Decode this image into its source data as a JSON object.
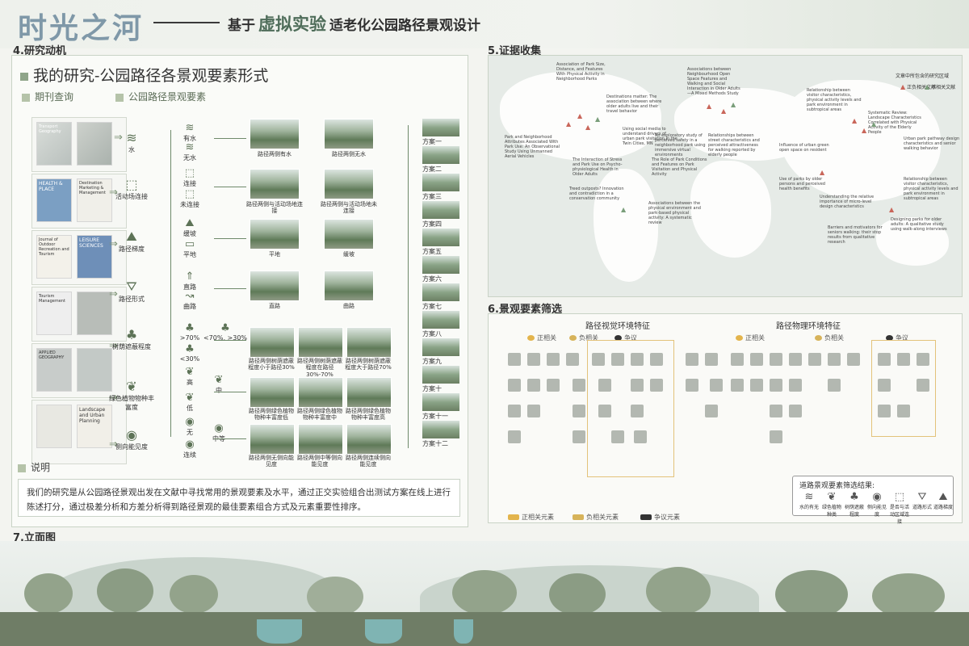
{
  "header": {
    "title": "时光之河",
    "subtitle_prefix": "基于",
    "subtitle_emph": "虚拟实验",
    "subtitle_suffix": "适老化公园路径景观设计"
  },
  "sections": {
    "s4": "4.研究动机",
    "s5": "5.证据收集",
    "s6": "6.景观要素筛选",
    "s7": "7.立面图"
  },
  "s4": {
    "heading": "我的研究-公园路径各景观要素形式",
    "sub1": "期刊查询",
    "sub2": "公园路径景观要素",
    "journals": [
      "Transport Geography",
      "HEALTH & PLACE",
      "Destination Marketing & Management",
      "LEISURE SCIENCES",
      "Journal of Outdoor Recreation and Tourism",
      "Tourism Management",
      "APPLIED GEOGRAPHY",
      "Landscape and Urban Planning"
    ],
    "factors": [
      {
        "name": "水",
        "levels": [
          "有水",
          "无水"
        ],
        "captions": [
          "路径两侧有水",
          "路径两侧无水"
        ]
      },
      {
        "name": "活动场连接",
        "levels": [
          "连接",
          "未连接"
        ],
        "captions": [
          "路径两侧与活动场地连接",
          "路径两侧与活动场地未连接"
        ]
      },
      {
        "name": "路径梯度",
        "levels": [
          "缓坡",
          "平地"
        ],
        "captions": [
          "平地",
          "缓坡"
        ]
      },
      {
        "name": "路径形式",
        "levels": [
          "直路",
          "曲路"
        ],
        "captions": [
          "直路",
          "曲路"
        ]
      },
      {
        "name": "树荫遮蔽程度",
        "levels": [
          ">70%",
          "<70%, >30%",
          "<30%"
        ],
        "captions": [
          "路径两侧树荫遮蔽程度小于路径30%",
          "路径两侧树荫遮蔽程度在路径30%-70%",
          "路径两侧树荫遮蔽程度大于路径70%"
        ]
      },
      {
        "name": "绿色植物物种丰富度",
        "levels": [
          "高",
          "中",
          "低"
        ],
        "captions": [
          "路径两侧绿色植物物种丰富度低",
          "路径两侧绿色植物物种丰富度中",
          "路径两侧绿色植物物种丰富度高"
        ]
      },
      {
        "name": "侧向能见度",
        "levels": [
          "无",
          "中等",
          "连续"
        ],
        "captions": [
          "路径两侧无侧向能见度",
          "路径两侧中等侧向能见度",
          "路径两侧连续侧向能见度"
        ]
      }
    ],
    "schemes": [
      "方案一",
      "方案二",
      "方案三",
      "方案四",
      "方案五",
      "方案六",
      "方案七",
      "方案八",
      "方案九",
      "方案十",
      "方案十一",
      "方案十二"
    ],
    "note_label": "说明",
    "note_text": "我们的研究是从公园路径景观出发在文献中寻找常用的景观要素及水平，通过正交实验组合出测试方案在线上进行陈述打分，通过极差分析和方差分析得到路径景观的最佳要素组合方式及元素重要性排序。"
  },
  "s5": {
    "legend_count": "文章中所包含的研究区域",
    "legend_pos": "正负相关文献",
    "legend_neg": "不相关文献",
    "annotations": [
      "Association of Park Size, Distance, and Features With Physical Activity in Neighborhood Parks",
      "Destinations matter: The association between where older adults live and their travel behavior",
      "Associations between Neighbourhood Open Space Features and Walking and Social Interaction in Older Adults—A Mixed Methods Study",
      "Relationship between visitor characteristics, physical activity levels and park environment in subtropical areas",
      "Using social media to understand drivers of urban park visitation in the Twin Cities, MN",
      "An exploratory study of perceived safety in a neighborhood park using immersive virtual environments",
      "Relationships between street characteristics and perceived attractiveness for walking reported by elderly people",
      "Park and Neighborhood Attributes Associated With Park Use: An Observational Study Using Unmanned Aerial Vehicles",
      "The Interaction of Stress and Park Use on Psycho-physiological Health in Older Adults",
      "The Role of Park Conditions and Features on Park Visitation and Physical Activity",
      "Influence of urban green open space on resident",
      "Urban park pathway design characteristics and senior walking behavior",
      "Systematic Review: Landscape Characteristics Correlated with Physical Activity of the Elderly People",
      "Use of parks by older persons and perceived health benefits",
      "Understanding the relative importance of micro-level design characteristics",
      "Relationship between visitor characteristics, physical activity levels and park environment in subtropical areas",
      "Treed outposts? Innovation and contradiction in a conservation community",
      "Associations between the physical environment and park-based physical activity: A systematic review",
      "Barriers and motivators for seniors walking: their stop results from qualitative research",
      "Designing parks for older adults: A qualitative study using walk-along interviews"
    ]
  },
  "s6": {
    "title_left": "路径视觉环境特征",
    "title_right": "路径物理环境特征",
    "pos": "正相关",
    "neg": "负相关",
    "dispute": "争议",
    "legend_pos": "正相关元素",
    "legend_neg": "负相关元素",
    "legend_dispute": "争议元素",
    "result_title": "道路景观要素筛选结果:",
    "results": [
      "水的有无",
      "绿色植物种类",
      "树荫遮蔽程度",
      "侧向能见度",
      "是否与活动区域连接",
      "道路形式",
      "道路梯度"
    ]
  },
  "colors": {
    "title": "#7f98a8",
    "accent": "#4f6d5a",
    "positive": "#e3b44c",
    "negative": "#d7b35a",
    "dispute": "#333333"
  }
}
